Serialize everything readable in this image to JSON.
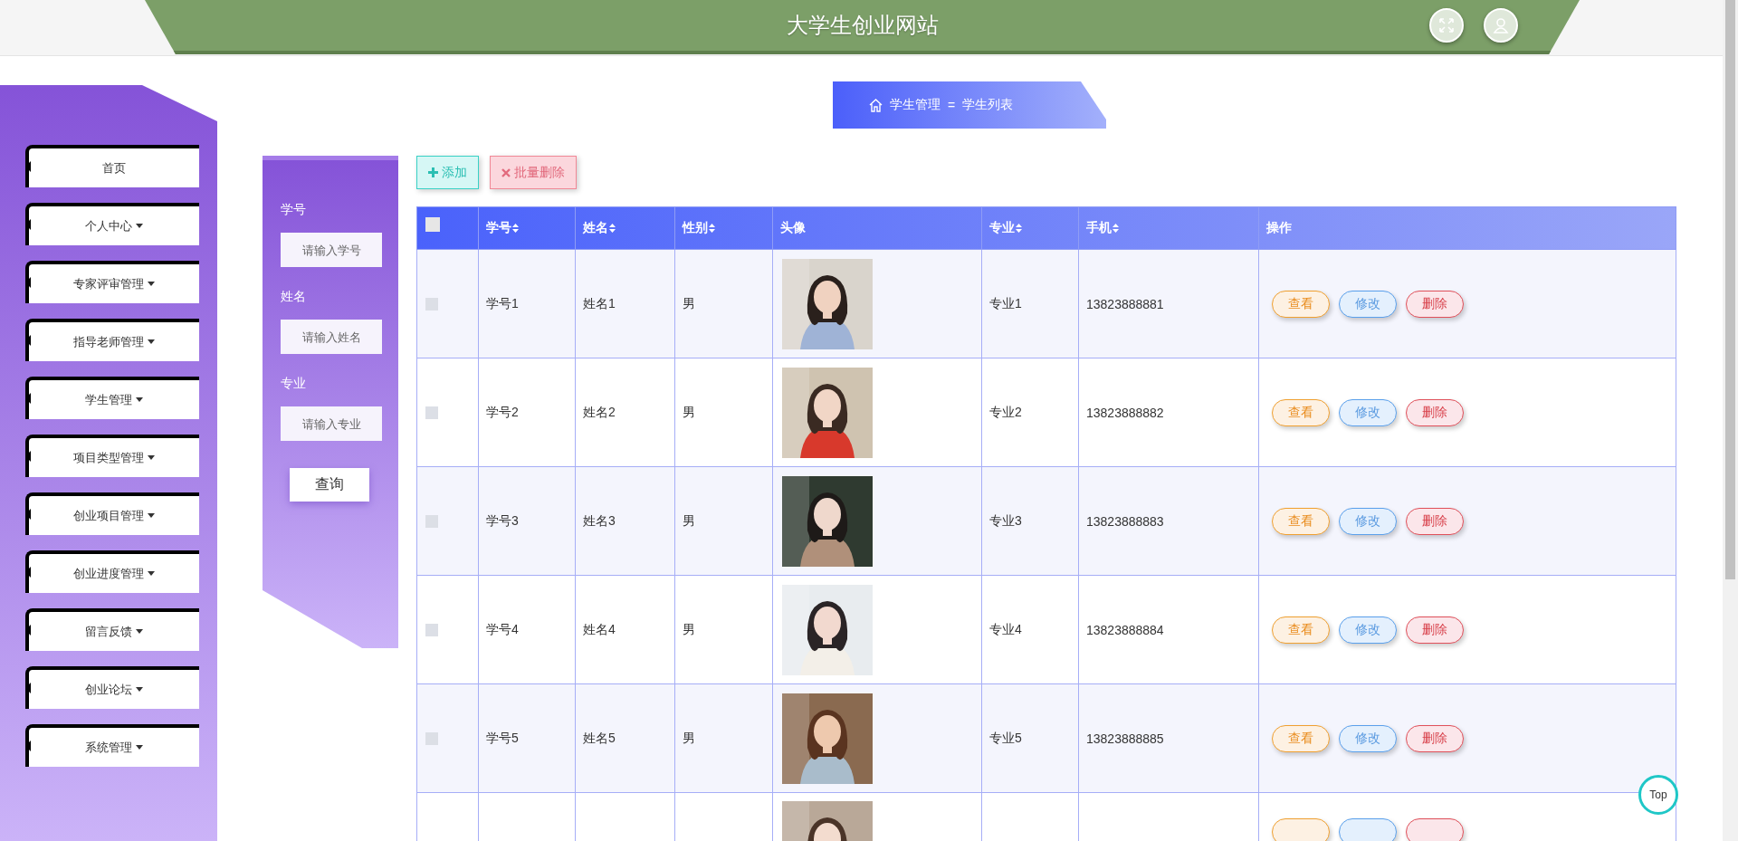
{
  "header": {
    "title": "大学生创业网站"
  },
  "sidebar": {
    "items": [
      {
        "label": "首页",
        "expandable": false
      },
      {
        "label": "个人中心",
        "expandable": true
      },
      {
        "label": "专家评审管理",
        "expandable": true
      },
      {
        "label": "指导老师管理",
        "expandable": true
      },
      {
        "label": "学生管理",
        "expandable": true
      },
      {
        "label": "项目类型管理",
        "expandable": true
      },
      {
        "label": "创业项目管理",
        "expandable": true
      },
      {
        "label": "创业进度管理",
        "expandable": true
      },
      {
        "label": "留言反馈",
        "expandable": true
      },
      {
        "label": "创业论坛",
        "expandable": true
      },
      {
        "label": "系统管理",
        "expandable": true
      }
    ]
  },
  "breadcrumb": {
    "items": [
      "学生管理",
      "学生列表"
    ],
    "separator": "="
  },
  "search": {
    "fields": [
      {
        "label": "学号",
        "placeholder": "请输入学号"
      },
      {
        "label": "姓名",
        "placeholder": "请输入姓名"
      },
      {
        "label": "专业",
        "placeholder": "请输入专业"
      }
    ],
    "button": "查询"
  },
  "toolbar": [
    {
      "kind": "add",
      "label": "添加"
    },
    {
      "kind": "delete",
      "label": "批量删除"
    }
  ],
  "table": {
    "select_all": {
      "checked": false
    },
    "columns": [
      {
        "label": "学号",
        "sortable": true
      },
      {
        "label": "姓名",
        "sortable": true
      },
      {
        "label": "性别",
        "sortable": true
      },
      {
        "label": "头像",
        "sortable": false
      },
      {
        "label": "专业",
        "sortable": true
      },
      {
        "label": "手机",
        "sortable": true
      },
      {
        "label": "操作",
        "sortable": false
      }
    ],
    "rows": [
      {
        "checked": false,
        "id": "学号1",
        "name": "姓名1",
        "gender": "男",
        "major": "专业1",
        "phone": "13823888881",
        "actions": [
          {
            "kind": "view",
            "label": "查看"
          },
          {
            "kind": "edit",
            "label": "修改"
          },
          {
            "kind": "delete",
            "label": "删除"
          }
        ]
      },
      {
        "checked": false,
        "id": "学号2",
        "name": "姓名2",
        "gender": "男",
        "major": "专业2",
        "phone": "13823888882",
        "actions": [
          {
            "kind": "view",
            "label": "查看"
          },
          {
            "kind": "edit",
            "label": "修改"
          },
          {
            "kind": "delete",
            "label": "删除"
          }
        ]
      },
      {
        "checked": false,
        "id": "学号3",
        "name": "姓名3",
        "gender": "男",
        "major": "专业3",
        "phone": "13823888883",
        "actions": [
          {
            "kind": "view",
            "label": "查看"
          },
          {
            "kind": "edit",
            "label": "修改"
          },
          {
            "kind": "delete",
            "label": "删除"
          }
        ]
      },
      {
        "checked": false,
        "id": "学号4",
        "name": "姓名4",
        "gender": "男",
        "major": "专业4",
        "phone": "13823888884",
        "actions": [
          {
            "kind": "view",
            "label": "查看"
          },
          {
            "kind": "edit",
            "label": "修改"
          },
          {
            "kind": "delete",
            "label": "删除"
          }
        ]
      },
      {
        "checked": false,
        "id": "学号5",
        "name": "姓名5",
        "gender": "男",
        "major": "专业5",
        "phone": "13823888885",
        "actions": [
          {
            "kind": "view",
            "label": "查看"
          },
          {
            "kind": "edit",
            "label": "修改"
          },
          {
            "kind": "delete",
            "label": "删除"
          }
        ]
      },
      {
        "actions": [
          {
            "kind": "view"
          },
          {
            "kind": "edit"
          },
          {
            "kind": "delete"
          }
        ]
      }
    ]
  },
  "back_to_top": "Top"
}
